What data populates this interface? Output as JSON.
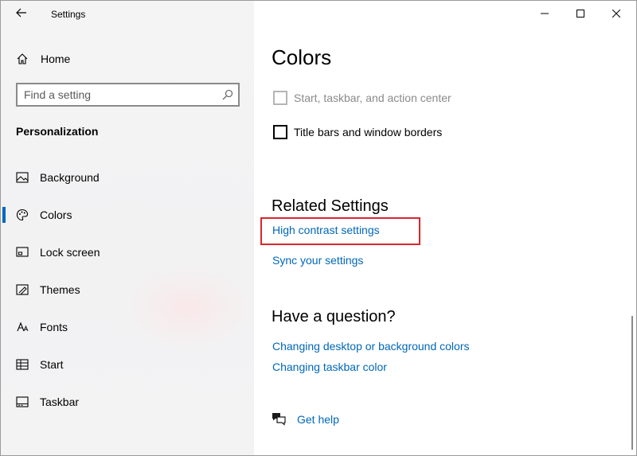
{
  "window": {
    "title": "Settings",
    "controls": {
      "minimize_icon": "minimize-icon",
      "maximize_icon": "maximize-icon",
      "close_icon": "close-icon"
    }
  },
  "sidebar": {
    "home_label": "Home",
    "search": {
      "placeholder": "Find a setting",
      "value": ""
    },
    "section_title": "Personalization",
    "items": [
      {
        "label": "Background",
        "icon": "picture-icon",
        "selected": false
      },
      {
        "label": "Colors",
        "icon": "palette-icon",
        "selected": true
      },
      {
        "label": "Lock screen",
        "icon": "lock-screen-icon",
        "selected": false
      },
      {
        "label": "Themes",
        "icon": "themes-icon",
        "selected": false
      },
      {
        "label": "Fonts",
        "icon": "fonts-icon",
        "selected": false
      },
      {
        "label": "Start",
        "icon": "start-icon",
        "selected": false
      },
      {
        "label": "Taskbar",
        "icon": "taskbar-icon",
        "selected": false
      }
    ]
  },
  "main": {
    "page_title": "Colors",
    "checkboxes": [
      {
        "label": "Start, taskbar, and action center",
        "checked": false,
        "disabled": true
      },
      {
        "label": "Title bars and window borders",
        "checked": false,
        "disabled": false
      }
    ],
    "related_settings": {
      "heading": "Related Settings",
      "links": [
        "High contrast settings",
        "Sync your settings"
      ]
    },
    "question": {
      "heading": "Have a question?",
      "links": [
        "Changing desktop or background colors",
        "Changing taskbar color"
      ]
    },
    "help": {
      "label": "Get help",
      "icon": "chat-help-icon"
    }
  },
  "colors": {
    "accent": "#0067c0",
    "link": "#0067b8",
    "highlight": "#d9262e"
  }
}
